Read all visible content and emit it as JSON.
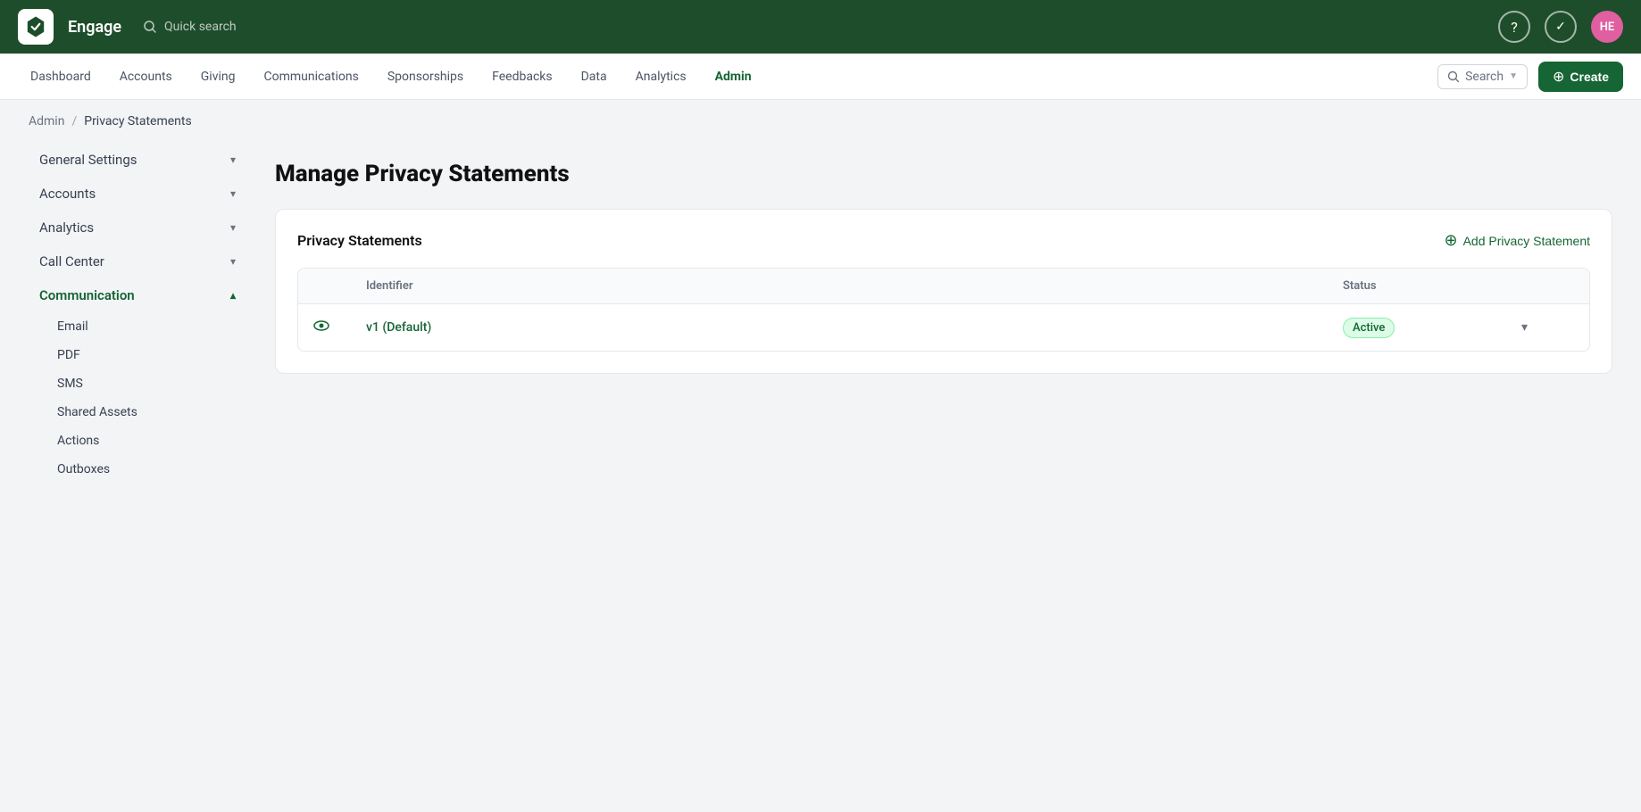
{
  "topbar": {
    "app_name": "Engage",
    "search_placeholder": "Quick search",
    "user_initials": "HE",
    "help_icon": "?",
    "tasks_icon": "✓"
  },
  "navbar": {
    "items": [
      {
        "label": "Dashboard",
        "active": false
      },
      {
        "label": "Accounts",
        "active": false
      },
      {
        "label": "Giving",
        "active": false
      },
      {
        "label": "Communications",
        "active": false
      },
      {
        "label": "Sponsorships",
        "active": false
      },
      {
        "label": "Feedbacks",
        "active": false
      },
      {
        "label": "Data",
        "active": false
      },
      {
        "label": "Analytics",
        "active": false
      },
      {
        "label": "Admin",
        "active": true
      }
    ],
    "search_label": "Search",
    "create_label": "Create"
  },
  "breadcrumb": {
    "parent": "Admin",
    "current": "Privacy Statements"
  },
  "sidebar": {
    "items": [
      {
        "label": "General Settings",
        "expanded": false,
        "active": false,
        "chevron": "down"
      },
      {
        "label": "Accounts",
        "expanded": false,
        "active": false,
        "chevron": "down"
      },
      {
        "label": "Analytics",
        "expanded": false,
        "active": false,
        "chevron": "down"
      },
      {
        "label": "Call Center",
        "expanded": false,
        "active": false,
        "chevron": "down"
      },
      {
        "label": "Communication",
        "expanded": true,
        "active": true,
        "chevron": "up"
      }
    ],
    "communication_subitems": [
      {
        "label": "Email"
      },
      {
        "label": "PDF"
      },
      {
        "label": "SMS"
      },
      {
        "label": "Shared Assets"
      },
      {
        "label": "Actions"
      },
      {
        "label": "Outboxes"
      }
    ]
  },
  "main": {
    "page_title": "Manage Privacy Statements",
    "card": {
      "title": "Privacy Statements",
      "add_button_label": "Add Privacy Statement",
      "table": {
        "columns": [
          "",
          "Identifier",
          "Status",
          ""
        ],
        "rows": [
          {
            "identifier": "v1 (Default)",
            "status": "Active"
          }
        ]
      }
    }
  }
}
